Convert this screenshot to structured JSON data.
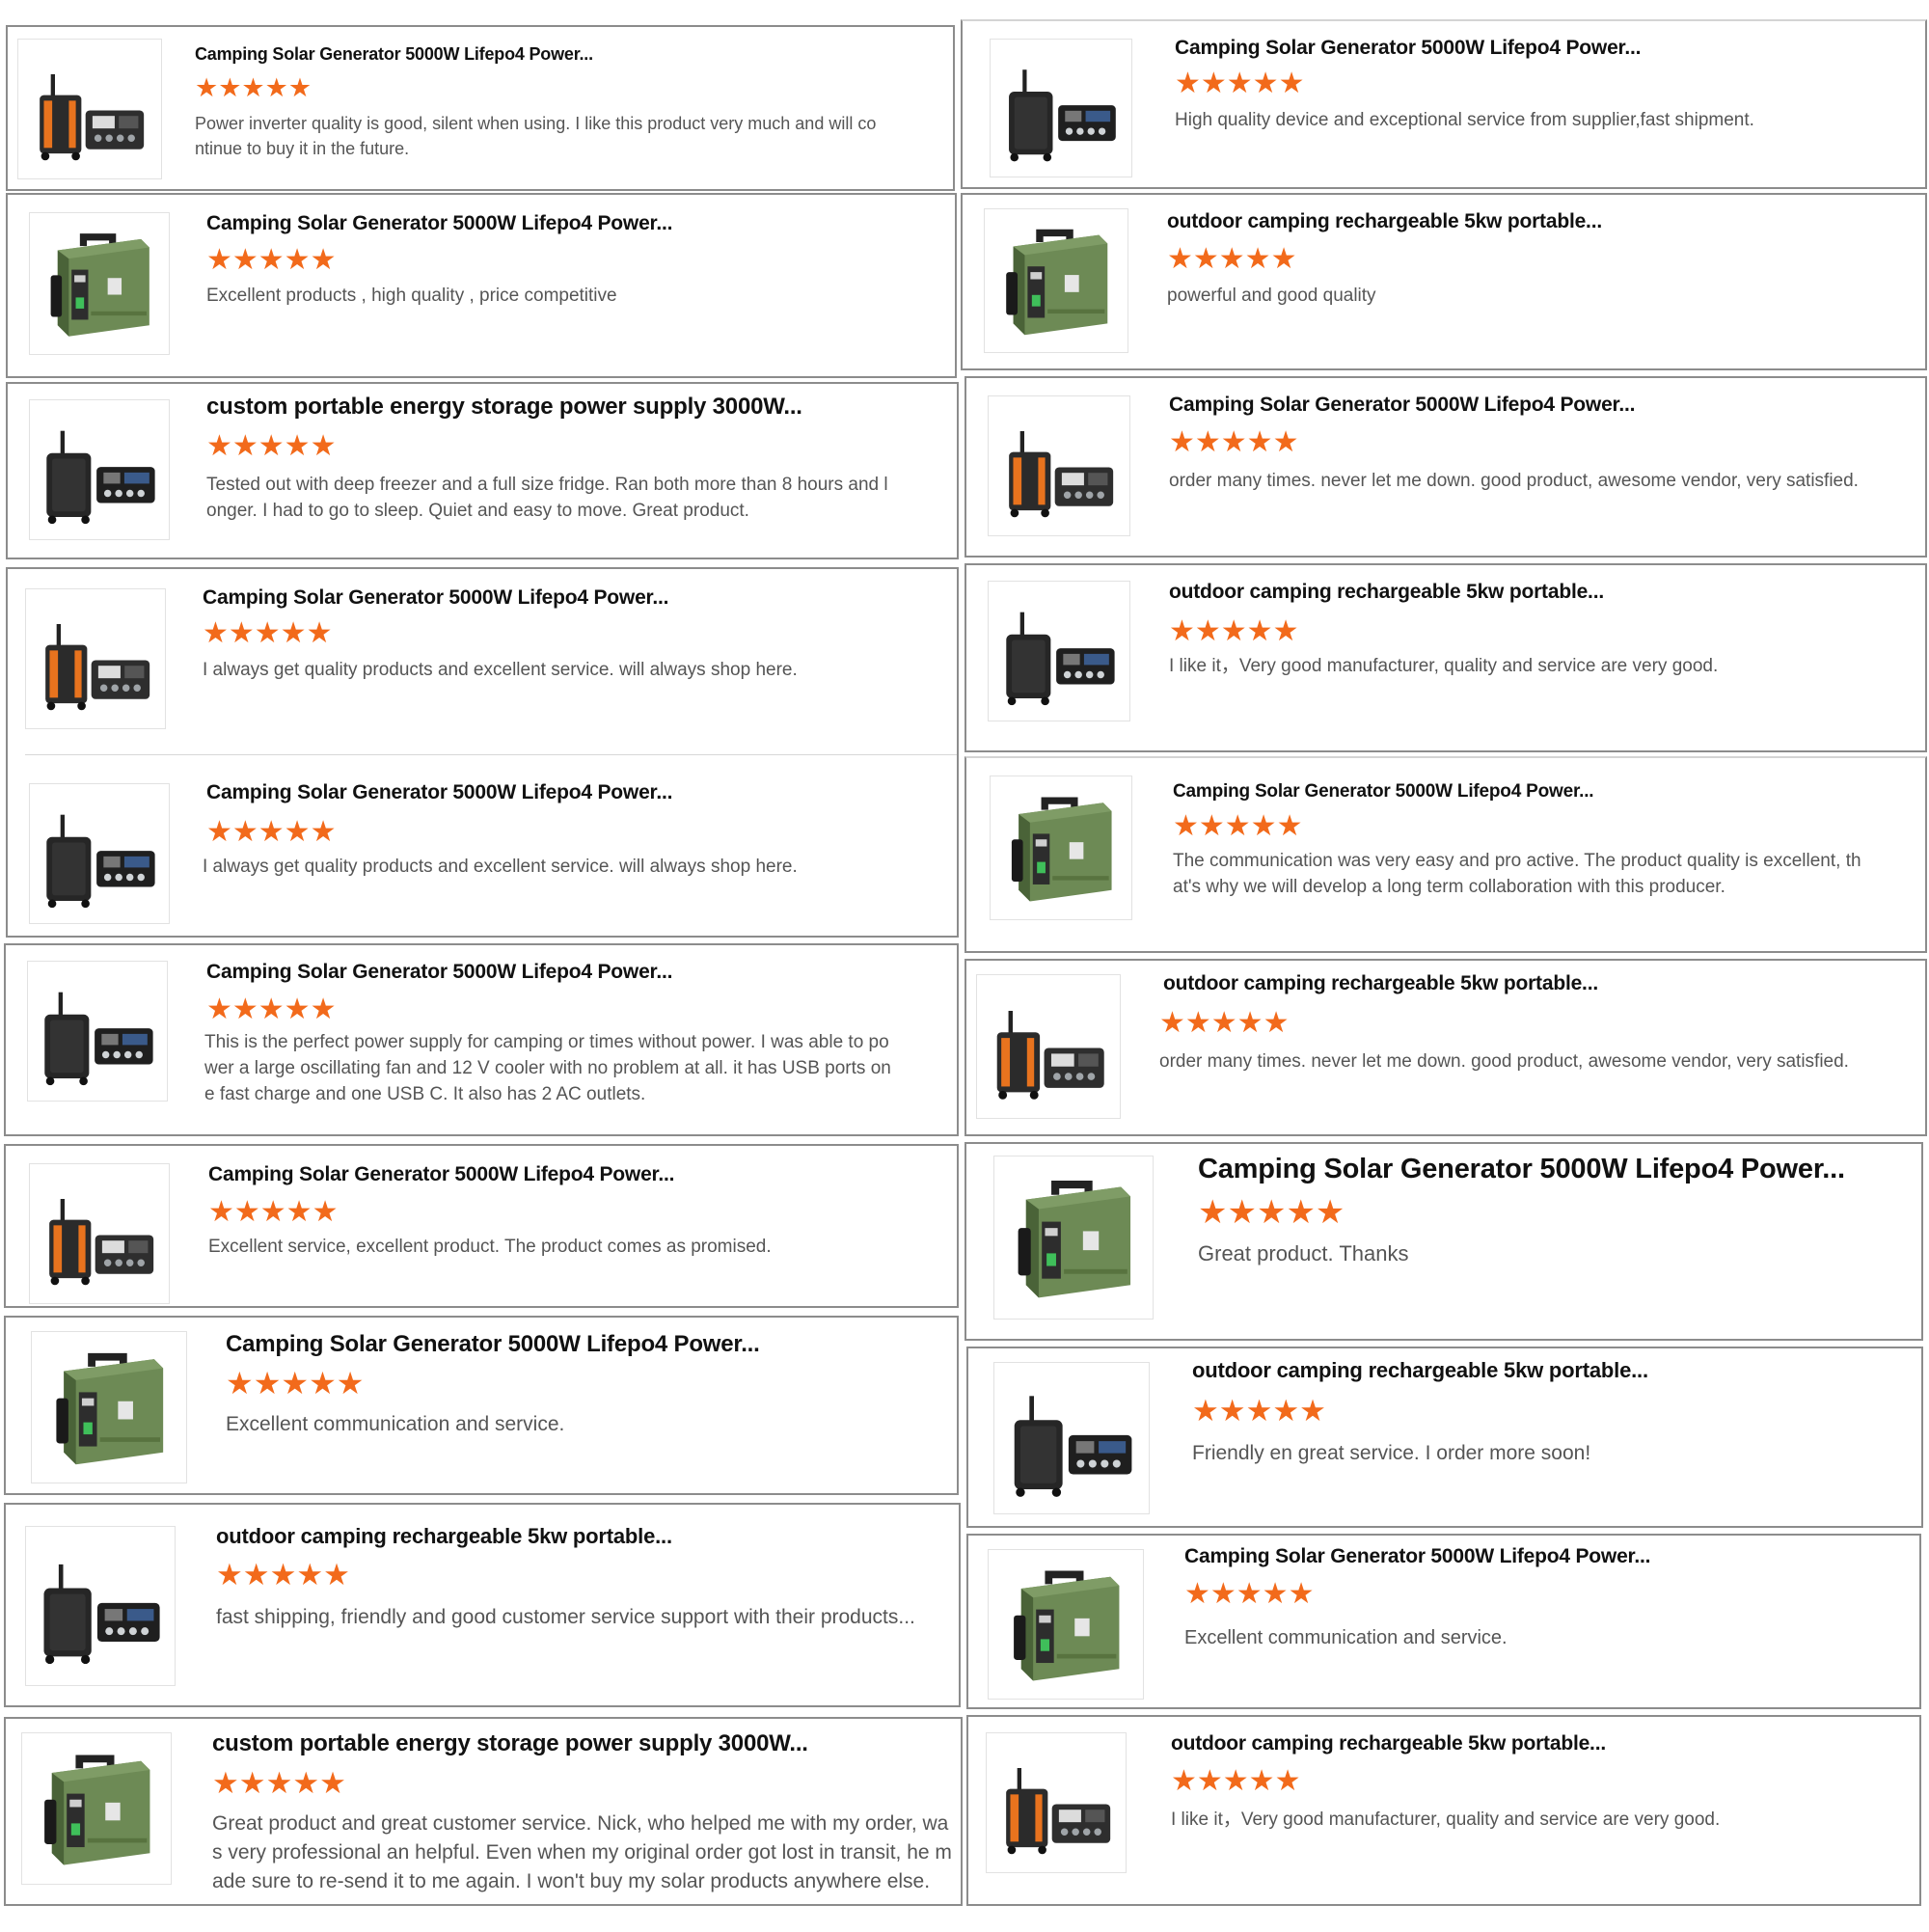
{
  "accent_color": "#f26a1b",
  "stars_glyph": "★★★★★",
  "reviews": [
    {
      "product": "Camping Solar Generator 5000W Lifepo4 Power...",
      "rating": 5,
      "text": "Power inverter quality is good, silent when using.  I like this product very much and will continue to buy it in the future.",
      "image_icon": "generator-black-orange-icon"
    },
    {
      "product": "Camping Solar Generator 5000W Lifepo4 Power...",
      "rating": 5,
      "text": "Excellent products , high quality , price competitive",
      "image_icon": "generator-green-case-icon"
    },
    {
      "product": "custom portable energy storage power supply 3000W...",
      "rating": 5,
      "text": "Tested out with deep freezer and a full size fridge. Ran both more than 8 hours and longer. I had to go to sleep. Quiet and easy to move. Great product.",
      "image_icon": "generator-black-case-icon"
    },
    {
      "product": "Camping Solar Generator 5000W Lifepo4 Power...",
      "rating": 5,
      "text": "I always get quality products and excellent service.  will always shop here.",
      "image_icon": "generator-black-orange-icon"
    },
    {
      "product": "Camping Solar Generator 5000W Lifepo4 Power...",
      "rating": 5,
      "text": "I always get quality products and excellent service.  will always shop here.",
      "image_icon": "generator-black-case-icon"
    },
    {
      "product": "Camping Solar Generator 5000W Lifepo4 Power...",
      "rating": 5,
      "text": "This is the perfect power supply for camping or times without power.   I was able to power a large oscillating fan and 12 V cooler with no problem at all.   it has USB ports one fast charge and one USB C. It also has 2 AC outlets.",
      "image_icon": "generator-black-case-icon"
    },
    {
      "product": "Camping Solar Generator 5000W Lifepo4 Power...",
      "rating": 5,
      "text": "Excellent service, excellent product. The product comes as promised.",
      "image_icon": "generator-black-orange-icon"
    },
    {
      "product": "Camping Solar Generator 5000W Lifepo4 Power...",
      "rating": 5,
      "text": "Excellent communication and service.",
      "image_icon": "generator-green-case-icon"
    },
    {
      "product": "outdoor camping rechargeable 5kw portable...",
      "rating": 5,
      "text": "fast shipping, friendly and good customer service support with their products...",
      "image_icon": "generator-black-case-icon"
    },
    {
      "product": "custom portable energy storage power supply 3000W...",
      "rating": 5,
      "text": "Great product and great customer service. Nick, who helped me with my order, was very professional an helpful. Even when my original order got lost in transit, he made sure to re-send it to me again. I won't buy my solar products anywhere else.",
      "image_icon": "generator-green-case-icon"
    },
    {
      "product": "Camping Solar Generator 5000W Lifepo4 Power...",
      "rating": 5,
      "text": "High quality device and exceptional service from supplier,fast shipment.",
      "image_icon": "generator-black-case-icon"
    },
    {
      "product": "outdoor camping rechargeable 5kw portable...",
      "rating": 5,
      "text": "powerful and good quality",
      "image_icon": "generator-green-case-icon"
    },
    {
      "product": "Camping Solar Generator 5000W Lifepo4 Power...",
      "rating": 5,
      "text": "order many times. never let me down. good product, awesome vendor, very satisfied.",
      "image_icon": "generator-black-orange-icon"
    },
    {
      "product": "outdoor camping rechargeable 5kw portable...",
      "rating": 5,
      "text": "I like it，Very good manufacturer, quality and service are very good.",
      "image_icon": "generator-black-case-icon"
    },
    {
      "product": "Camping Solar Generator 5000W Lifepo4 Power...",
      "rating": 5,
      "text": "The communication was very easy and pro active. The product quality is excellent, that's why we will develop a long term collaboration with this producer.",
      "image_icon": "generator-green-case-icon"
    },
    {
      "product": "outdoor camping rechargeable 5kw portable...",
      "rating": 5,
      "text": "order many times. never let me down. good product, awesome vendor, very satisfied.",
      "image_icon": "generator-black-orange-icon"
    },
    {
      "product": "Camping Solar Generator 5000W Lifepo4 Power...",
      "rating": 5,
      "text": "Great product. Thanks",
      "image_icon": "generator-green-case-icon"
    },
    {
      "product": "outdoor camping rechargeable 5kw portable...",
      "rating": 5,
      "text": "Friendly en great service. I order more soon!",
      "image_icon": "generator-black-case-icon"
    },
    {
      "product": "Camping Solar Generator 5000W Lifepo4 Power...",
      "rating": 5,
      "text": "Excellent communication and service.",
      "image_icon": "generator-green-case-icon"
    },
    {
      "product": "outdoor camping rechargeable 5kw portable...",
      "rating": 5,
      "text": "I like it，Very good manufacturer, quality and service are very good.",
      "image_icon": "generator-black-orange-icon"
    }
  ]
}
